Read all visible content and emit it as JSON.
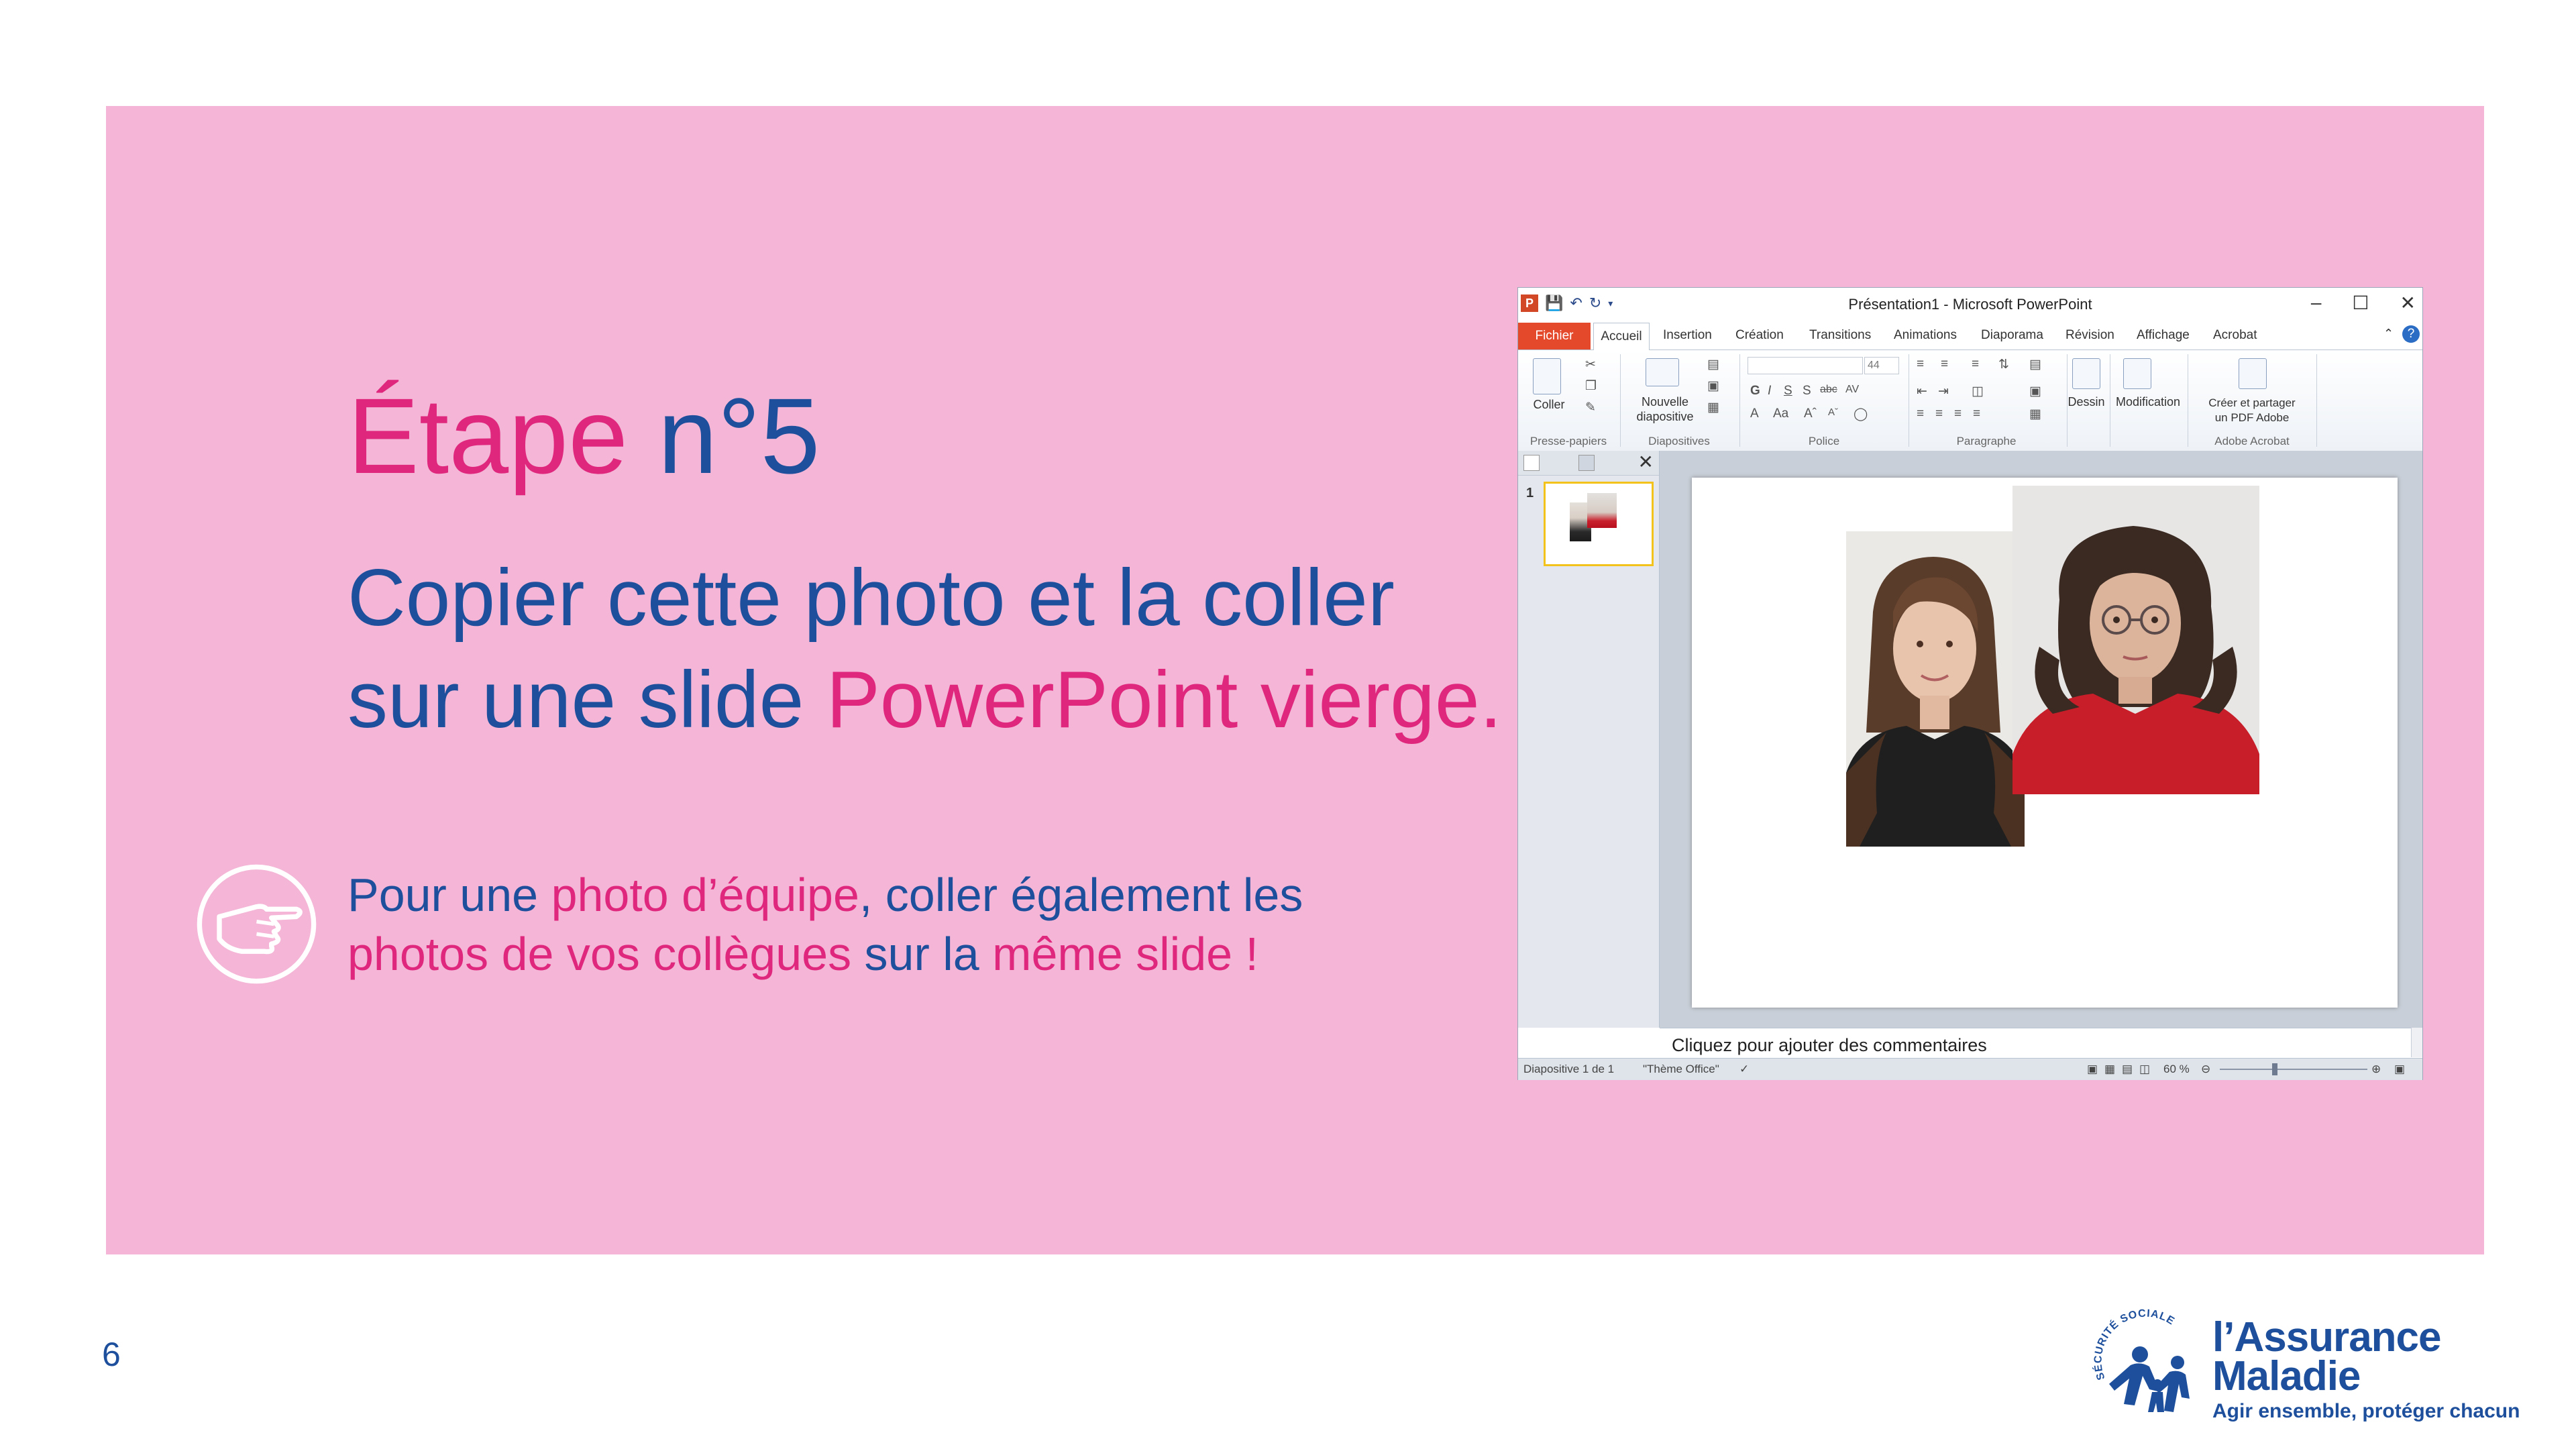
{
  "slide": {
    "step_title_part1": "Étape",
    "step_title_part2": "n°5",
    "subtitle_line1": "Copier cette photo et la coller",
    "subtitle_line2_a": "sur une slide ",
    "subtitle_line2_b": "PowerPoint vierge",
    "subtitle_line2_c": ".",
    "tip_a": "Pour une ",
    "tip_b": "photo d’équipe",
    "tip_c": ", coller également les",
    "tip_d": "photos de vos collègues",
    "tip_e": " sur la ",
    "tip_f": "même slide",
    "tip_g": " !",
    "hand_icon": "pointing-hand-icon",
    "page_number": "6",
    "colors": {
      "panel": "#f4b5d6",
      "pink": "#e0277e",
      "blue": "#1d4f9c"
    }
  },
  "powerpoint": {
    "window_title": "Présentation1 - Microsoft PowerPoint",
    "tabs": {
      "file": "Fichier",
      "home": "Accueil",
      "insert": "Insertion",
      "design": "Création",
      "transitions": "Transitions",
      "animations": "Animations",
      "slideshow": "Diaporama",
      "review": "Révision",
      "view": "Affichage",
      "acrobat": "Acrobat"
    },
    "ribbon": {
      "paste": "Coller",
      "new_slide_1": "Nouvelle",
      "new_slide_2": "diapositive",
      "font_size": "44",
      "drawing": "Dessin",
      "editing": "Modification",
      "create_pdf_1": "Créer et partager",
      "create_pdf_2": "un PDF Adobe",
      "group_clipboard": "Presse-papiers",
      "group_slides": "Diapositives",
      "group_font": "Police",
      "group_paragraph": "Paragraphe",
      "group_acrobat": "Adobe Acrobat"
    },
    "thumbnail_number": "1",
    "notes_placeholder": "Cliquez pour ajouter des commentaires",
    "status": {
      "slide_count": "Diapositive 1 de 1",
      "theme": "\"Thème Office\"",
      "zoom": "60 %"
    }
  },
  "logo": {
    "name_line1": "l’Assurance",
    "name_line2": "Maladie",
    "tagline": "Agir ensemble, protéger chacun",
    "seal_text": "SÉCURITÉ SOCIALE"
  }
}
